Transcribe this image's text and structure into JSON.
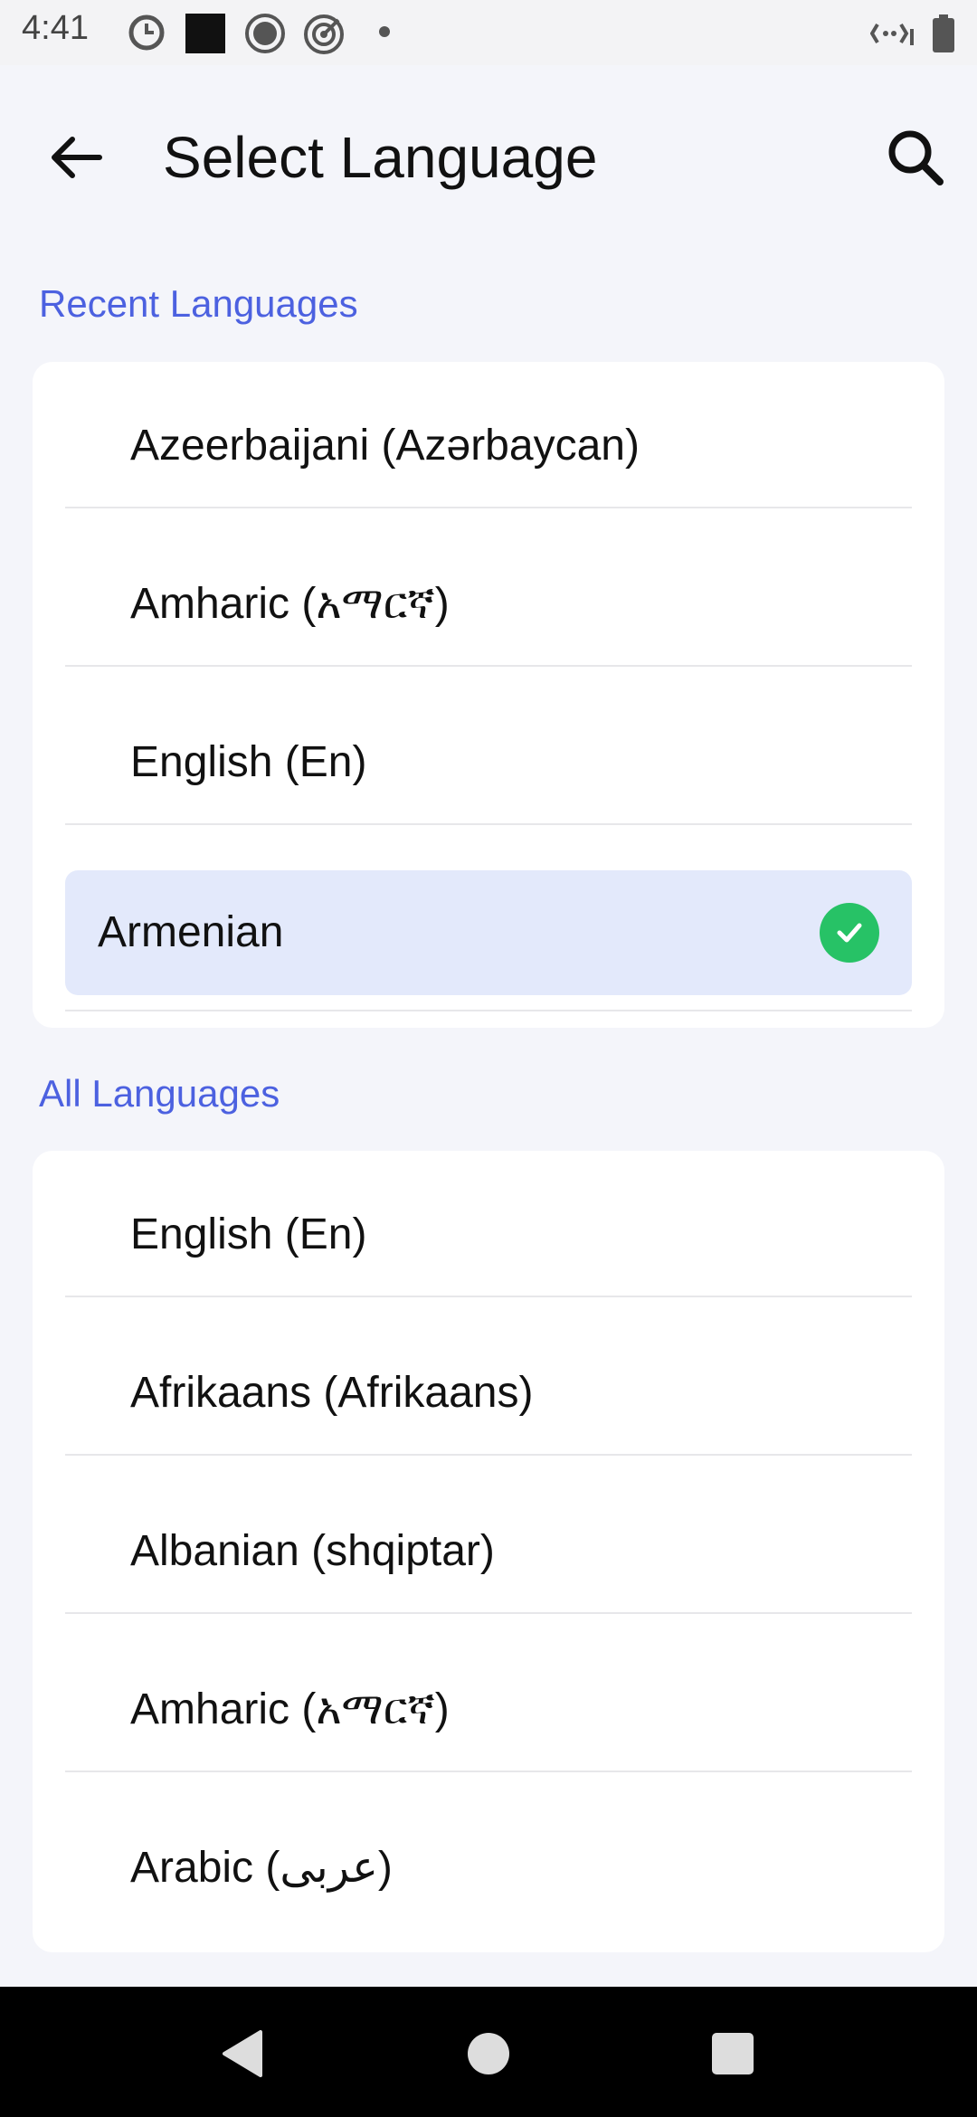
{
  "status_bar": {
    "time": "4:41",
    "icons": [
      "do-not-disturb-icon",
      "square-icon",
      "record-icon",
      "target-icon",
      "dot-icon",
      "signal-icon",
      "battery-icon"
    ]
  },
  "header": {
    "title": "Select Language",
    "back_icon": "arrow-left-icon",
    "search_icon": "search-icon"
  },
  "recent": {
    "title": "Recent Languages",
    "items": [
      {
        "label": "Azeerbaijani (Azərbaycan)",
        "selected": false
      },
      {
        "label": "Amharic (አማርኛ)",
        "selected": false
      },
      {
        "label": "English (En)",
        "selected": false
      },
      {
        "label": "Armenian",
        "selected": true
      }
    ]
  },
  "all": {
    "title": "All Languages",
    "items": [
      {
        "label": "English (En)"
      },
      {
        "label": "Afrikaans (Afrikaans)"
      },
      {
        "label": "Albanian (shqiptar)"
      },
      {
        "label": "Amharic (አማርኛ)"
      },
      {
        "label": "Arabic (عربى)"
      }
    ]
  },
  "colors": {
    "accent": "#4c61e0",
    "selected_bg": "#e3e9fb",
    "check": "#27c266"
  },
  "nav": {
    "back": "nav-back-icon",
    "home": "nav-home-icon",
    "recents": "nav-recents-icon"
  }
}
